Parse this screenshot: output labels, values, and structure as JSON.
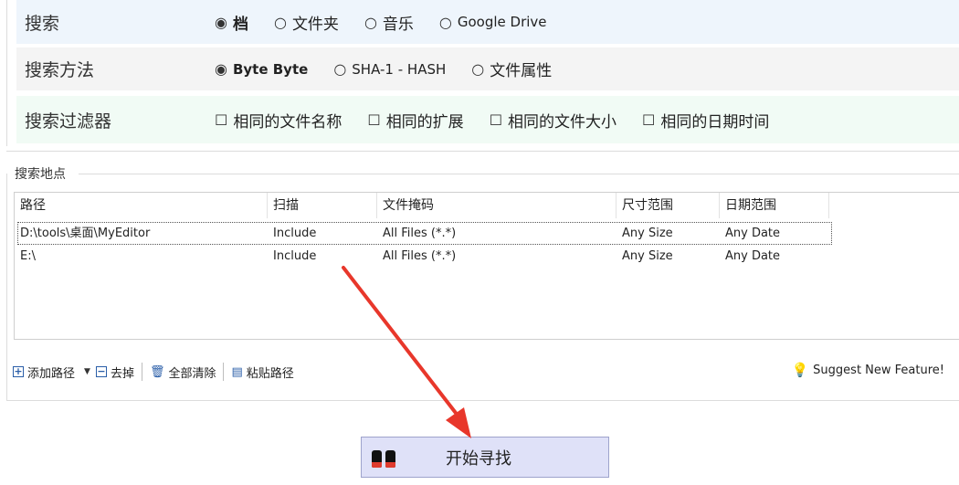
{
  "search_options": {
    "label": "搜索",
    "options": [
      {
        "label": "档",
        "selected": true
      },
      {
        "label": "文件夹",
        "selected": false
      },
      {
        "label": "音乐",
        "selected": false
      },
      {
        "label": "Google Drive",
        "selected": false
      }
    ]
  },
  "search_method": {
    "label": "搜索方法",
    "options": [
      {
        "label": "Byte Byte",
        "selected": true
      },
      {
        "label": "SHA-1 - HASH",
        "selected": false
      },
      {
        "label": "文件属性",
        "selected": false
      }
    ]
  },
  "search_filter": {
    "label": "搜索过滤器",
    "checkboxes": [
      {
        "label": "相同的文件名称",
        "checked": false
      },
      {
        "label": "相同的扩展",
        "checked": false
      },
      {
        "label": "相同的文件大小",
        "checked": false
      },
      {
        "label": "相同的日期时间",
        "checked": false
      }
    ]
  },
  "locations": {
    "title": "搜索地点",
    "columns": [
      "路径",
      "扫描",
      "文件掩码",
      "尺寸范围",
      "日期范围"
    ],
    "rows": [
      [
        "D:\\tools\\桌面\\MyEditor",
        "Include",
        "All Files (*.*)",
        "Any Size",
        "Any Date"
      ],
      [
        "E:\\",
        "Include",
        "All Files (*.*)",
        "Any Size",
        "Any Date"
      ]
    ]
  },
  "toolbar": {
    "add_path": "添加路径",
    "remove": "去掉",
    "clear_all": "全部清除",
    "paste_path": "粘贴路径",
    "suggest": "Suggest New Feature!"
  },
  "start_button": {
    "label": "开始寻找"
  },
  "glyphs": {
    "radio_on": "◉",
    "radio_off": "○",
    "checkbox": "☐",
    "plus": "+",
    "minus": "−",
    "caret": "▼",
    "trash": "🗑",
    "paste": "▤",
    "bulb": "💡"
  },
  "icons": [
    "radio-icon",
    "checkbox-icon",
    "add-icon",
    "remove-icon",
    "trash-icon",
    "paste-icon",
    "bulb-icon",
    "binoculars-icon"
  ],
  "colors": {
    "accent_arrow": "#e8372b",
    "button_bg": "#dfe1f8",
    "row_search_bg": "#eef5fc",
    "row_filter_bg": "#f1fbf5"
  }
}
